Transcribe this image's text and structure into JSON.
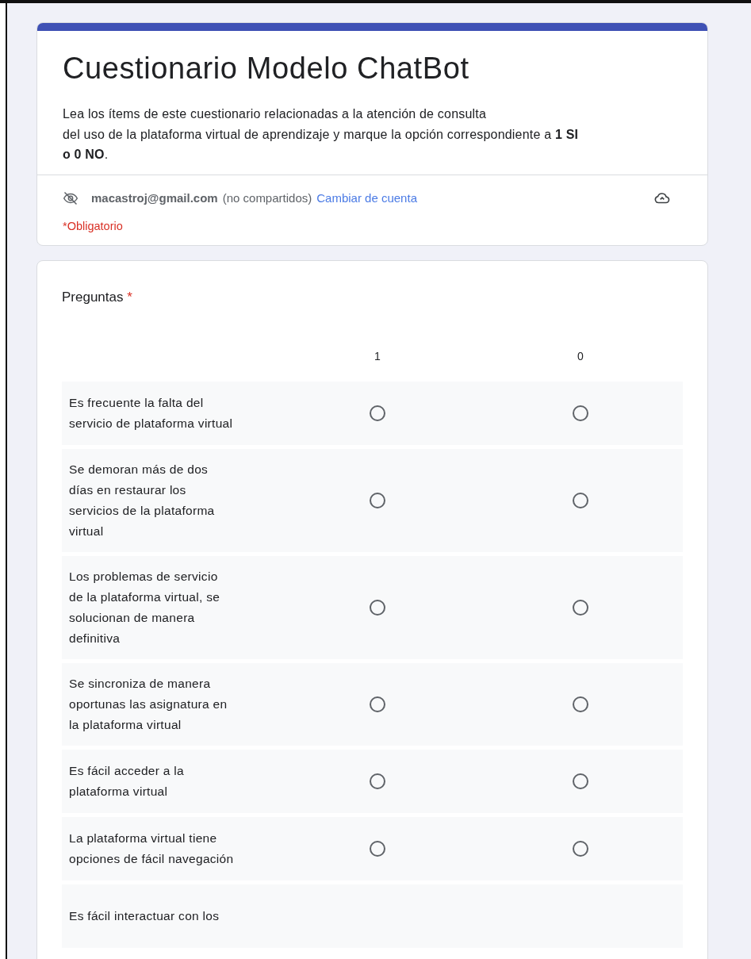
{
  "form": {
    "title": "Cuestionario Modelo ChatBot",
    "description": "Lea los ítems de este cuestionario relacionadas a la atención de consulta\ndel uso de la plataforma virtual de aprendizaje y marque la opción correspondiente a **1 SI**\n**o  0 NO**.",
    "account": {
      "email": "macastroj@gmail.com",
      "note": "(no compartidos)",
      "switch_link": "Cambiar de cuenta"
    },
    "required_note": "*Obligatorio"
  },
  "question": {
    "title": "Preguntas",
    "required_mark": "*",
    "columns": [
      "1",
      "0"
    ],
    "rows": [
      {
        "label": "Es frecuente la falta del\nservicio de plataforma virtual",
        "options": [
          {
            "selected": false
          },
          {
            "selected": false
          }
        ]
      },
      {
        "label": "Se demoran más de dos\ndías en restaurar los\nservicios de la plataforma\nvirtual",
        "options": [
          {
            "selected": false
          },
          {
            "selected": false
          }
        ]
      },
      {
        "label": "Los problemas de servicio\nde la plataforma virtual, se\nsolucionan de manera\ndefinitiva",
        "options": [
          {
            "selected": false
          },
          {
            "selected": false
          }
        ]
      },
      {
        "label": "Se sincroniza de manera\noportunas las asignatura en\nla plataforma virtual",
        "options": [
          {
            "selected": false
          },
          {
            "selected": false
          }
        ]
      },
      {
        "label": "Es fácil acceder a la\nplataforma virtual",
        "options": [
          {
            "selected": false
          },
          {
            "selected": false
          }
        ]
      },
      {
        "label": "La plataforma virtual tiene\nopciones de fácil navegación",
        "options": [
          {
            "selected": false
          },
          {
            "selected": false
          }
        ]
      },
      {
        "label": "Es fácil interactuar con los"
      }
    ]
  }
}
